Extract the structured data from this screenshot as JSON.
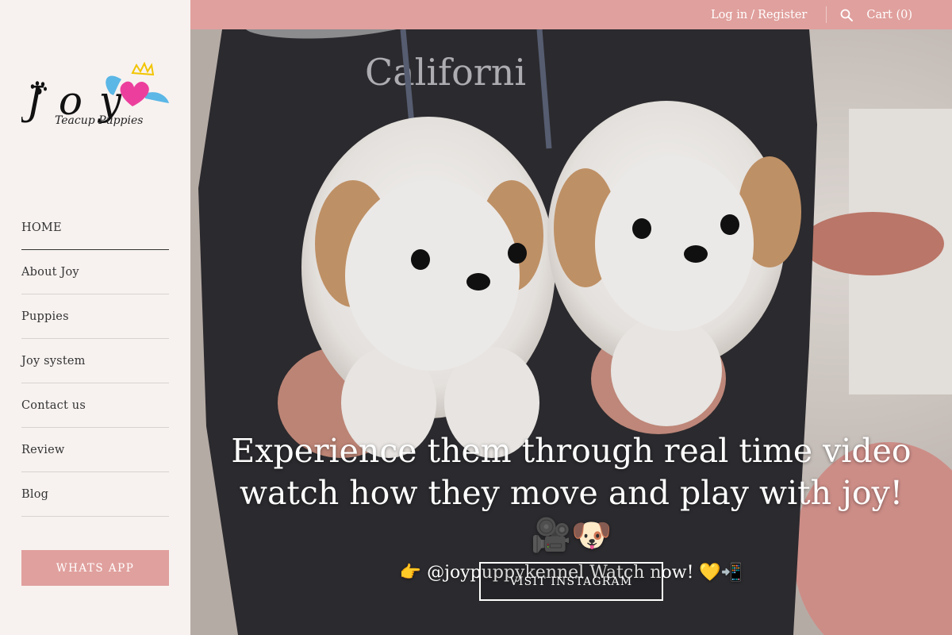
{
  "brand": {
    "name": "Joy",
    "tagline": "Teacup Puppies"
  },
  "sidebar": {
    "nav": [
      {
        "label": "HOME"
      },
      {
        "label": "About Joy"
      },
      {
        "label": "Puppies"
      },
      {
        "label": "Joy system"
      },
      {
        "label": "Contact us"
      },
      {
        "label": "Review"
      },
      {
        "label": "Blog"
      }
    ],
    "whatsapp_label": "WHATS APP"
  },
  "topbar": {
    "login": "Log in",
    "separator": "/",
    "register": "Register",
    "search_icon": "search-icon",
    "cart": "Cart (0)"
  },
  "hero": {
    "title_line1": "Experience them through real time video",
    "title_line2": "watch how they move and play with joy! 🎥🐶",
    "subtitle": "👉 @joypuppykennel Watch now! 💛📲",
    "button_label": "VISIT INSTAGRAM"
  },
  "colors": {
    "accent": "#e0a09d",
    "sidebar_bg": "#f7f2f0",
    "text": "#333333",
    "whatsapp_green": "#25d366"
  }
}
